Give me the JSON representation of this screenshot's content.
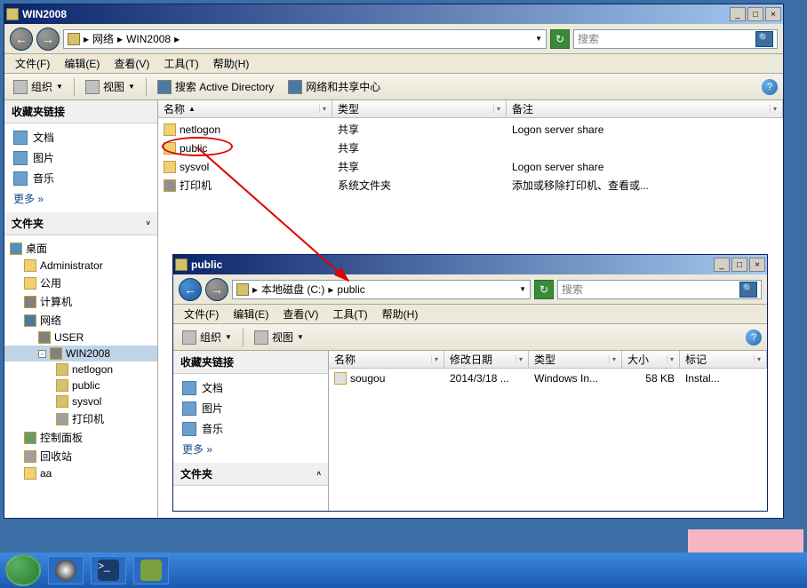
{
  "main_window": {
    "title": "WIN2008",
    "nav": {
      "back": "←",
      "fwd": "→"
    },
    "breadcrumb": {
      "root": "网络",
      "node": "WIN2008"
    },
    "search_placeholder": "搜索",
    "menu": {
      "file": "文件(F)",
      "edit": "编辑(E)",
      "view": "查看(V)",
      "tools": "工具(T)",
      "help": "帮助(H)"
    },
    "toolbar": {
      "organize": "组织",
      "views": "视图",
      "search_ad": "搜索 Active Directory",
      "net_center": "网络和共享中心"
    },
    "left": {
      "fav_header": "收藏夹链接",
      "favs": {
        "docs": "文档",
        "pics": "图片",
        "music": "音乐",
        "more": "更多 »"
      },
      "folders_header": "文件夹",
      "tree": {
        "desktop": "桌面",
        "admin": "Administrator",
        "public_user": "公用",
        "computer": "计算机",
        "network": "网络",
        "user_node": "USER",
        "win2008": "WIN2008",
        "netlogon": "netlogon",
        "public": "public",
        "sysvol": "sysvol",
        "printers": "打印机",
        "ctrlpanel": "控制面板",
        "recycle": "回收站",
        "aa": "aa"
      }
    },
    "cols": {
      "name": "名称",
      "type": "类型",
      "remark": "备注"
    },
    "rows": [
      {
        "name": "netlogon",
        "type": "共享",
        "remark": "Logon server share",
        "icon": "share"
      },
      {
        "name": "public",
        "type": "共享",
        "remark": "",
        "icon": "share"
      },
      {
        "name": "sysvol",
        "type": "共享",
        "remark": "Logon server share",
        "icon": "share"
      },
      {
        "name": "打印机",
        "type": "系统文件夹",
        "remark": "添加或移除打印机、查看或...",
        "icon": "printer"
      }
    ]
  },
  "sub_window": {
    "title": "public",
    "breadcrumb": {
      "disk": "本地磁盘 (C:)",
      "folder": "public"
    },
    "search_placeholder": "搜索",
    "menu": {
      "file": "文件(F)",
      "edit": "编辑(E)",
      "view": "查看(V)",
      "tools": "工具(T)",
      "help": "帮助(H)"
    },
    "toolbar": {
      "organize": "组织",
      "views": "视图"
    },
    "left": {
      "fav_header": "收藏夹链接",
      "favs": {
        "docs": "文档",
        "pics": "图片",
        "music": "音乐",
        "more": "更多 »"
      },
      "folders_header": "文件夹"
    },
    "cols": {
      "name": "名称",
      "date": "修改日期",
      "type": "类型",
      "size": "大小",
      "tags": "标记"
    },
    "rows": [
      {
        "name": "sougou",
        "date": "2014/3/18 ...",
        "type": "Windows In...",
        "size": "58 KB",
        "tags": "Instal..."
      }
    ]
  },
  "taskbar": {
    "items": [
      "qq",
      "powershell",
      "vmware"
    ]
  }
}
